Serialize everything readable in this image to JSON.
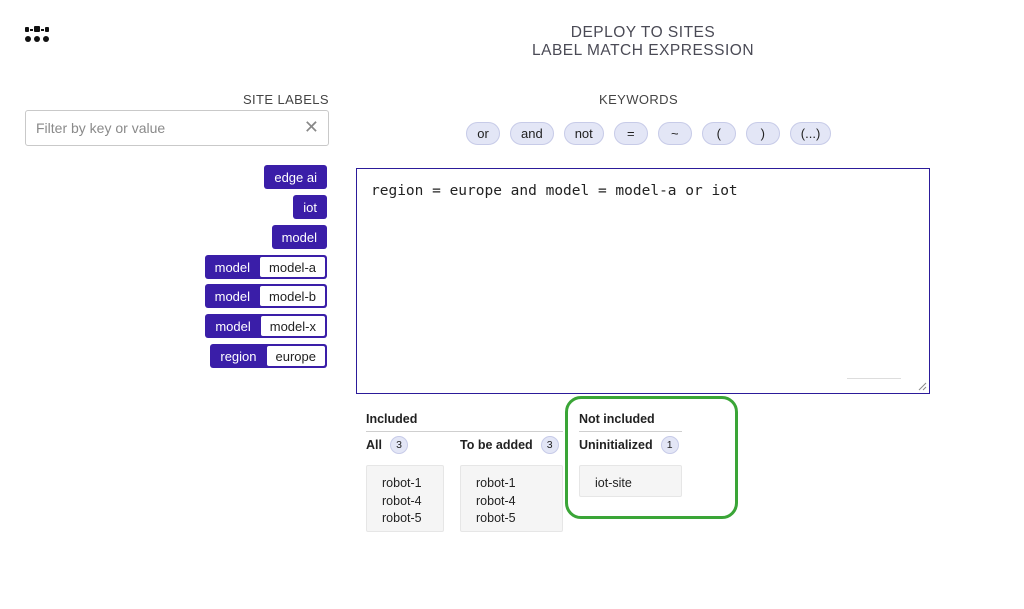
{
  "header": {
    "title_line1": "DEPLOY TO SITES",
    "title_line2": "LABEL MATCH EXPRESSION"
  },
  "site_labels": {
    "heading": "SITE LABELS",
    "filter_placeholder": "Filter by key or value",
    "clear_icon": "close-icon",
    "chips": [
      {
        "key": "edge ai",
        "value": ""
      },
      {
        "key": "iot",
        "value": ""
      },
      {
        "key": "model",
        "value": ""
      },
      {
        "key": "model",
        "value": "model-a"
      },
      {
        "key": "model",
        "value": "model-b"
      },
      {
        "key": "model",
        "value": "model-x"
      },
      {
        "key": "region",
        "value": "europe"
      }
    ]
  },
  "keywords": {
    "heading": "KEYWORDS",
    "items": [
      "or",
      "and",
      "not",
      "=",
      "~",
      "(",
      ")",
      "(...)"
    ]
  },
  "editor": {
    "expression": "region = europe and model = model-a or iot"
  },
  "results": {
    "included": {
      "heading": "Included",
      "all": {
        "label": "All",
        "count": "3",
        "sites": [
          "robot-1",
          "robot-4",
          "robot-5"
        ]
      },
      "to_be_added": {
        "label": "To be added",
        "count": "3",
        "sites": [
          "robot-1",
          "robot-4",
          "robot-5"
        ]
      }
    },
    "not_included": {
      "heading": "Not included",
      "uninitialized": {
        "label": "Uninitialized",
        "count": "1",
        "sites": [
          "iot-site"
        ]
      }
    }
  },
  "colors": {
    "accent": "#3a1ea8",
    "keyword_bg": "#e3e6f6",
    "highlight": "#3aa537"
  }
}
